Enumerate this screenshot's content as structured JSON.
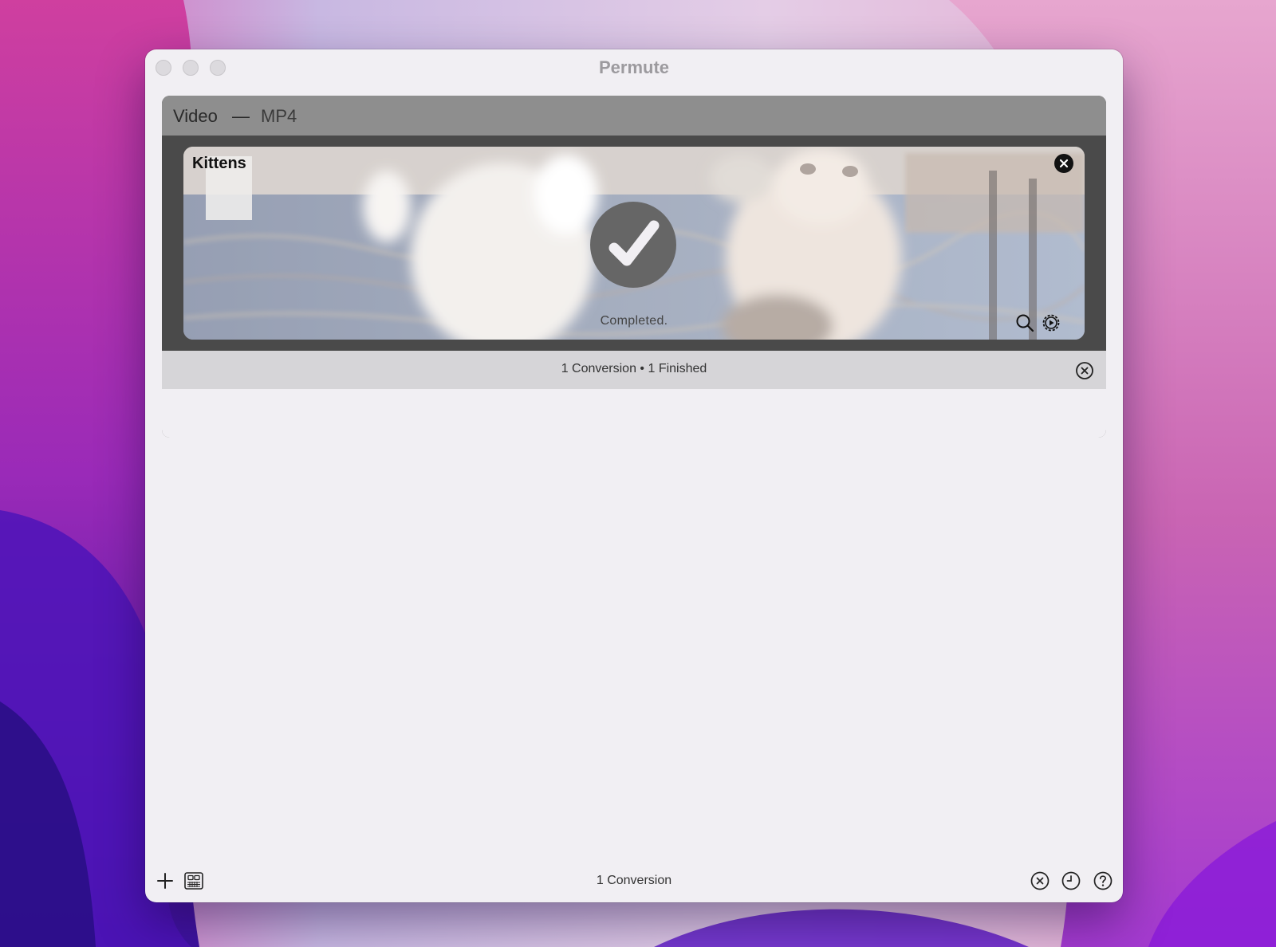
{
  "window": {
    "title": "Permute"
  },
  "group": {
    "type_label": "Video",
    "separator": "—",
    "format_label": "MP4"
  },
  "conversion": {
    "file_name": "Kittens",
    "status": "Completed."
  },
  "group_summary": {
    "text": "1 Conversion • 1 Finished"
  },
  "bottom_bar": {
    "count_text": "1 Conversion"
  },
  "icons": {
    "remove": "close-icon",
    "done": "checkmark-icon",
    "reveal": "search-icon",
    "settings": "gear-icon",
    "cancel_all": "cancel-circle-icon",
    "add": "plus-icon",
    "media_browser": "media-browser-icon",
    "history": "clock-icon",
    "help": "help-icon"
  },
  "colors": {
    "window_bg": "#f1eff3",
    "group_header": "#8e8e8e",
    "summary_bar": "#d6d5d8",
    "done_badge": "#666666"
  }
}
